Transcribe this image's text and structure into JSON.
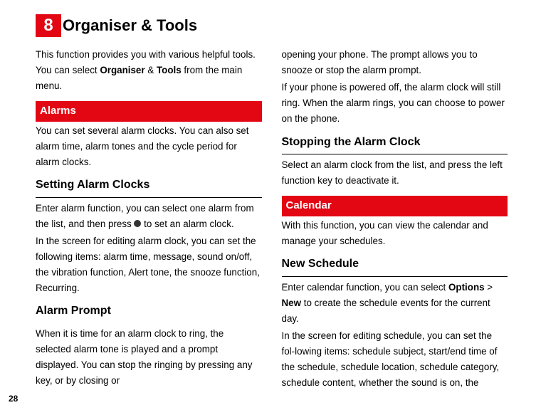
{
  "chapter": {
    "number": "8",
    "title": "Organiser & Tools"
  },
  "left": {
    "intro_pre": "This function provides you with various helpful tools. You can select ",
    "intro_bold1": "Organiser",
    "intro_amp": " & ",
    "intro_bold2": "Tools",
    "intro_post": " from the main menu.",
    "alarms_bar": "Alarms",
    "alarms_intro": "You can set several alarm clocks. You can also set alarm time, alarm tones and the cycle period for alarm clocks.",
    "setting_heading": "Setting Alarm Clocks",
    "setting_p1_pre": "Enter alarm function, you can select one alarm from the list, and then press ",
    "setting_p1_post": " to set an alarm clock.",
    "setting_p2": "In the screen for editing alarm clock, you can set the following items: alarm time, message, sound on/off, the vibration function, Alert tone, the snooze function, Recurring.",
    "prompt_heading": "Alarm Prompt",
    "prompt_p1": "When it is time for an alarm clock to ring, the selected alarm tone is played and a prompt displayed. You can stop the ringing by pressing any key, or by closing or"
  },
  "right": {
    "prompt_cont": "opening your phone. The prompt allows you to snooze or stop the alarm prompt.",
    "prompt_p2": "If your phone is powered off, the alarm clock will still ring. When the alarm rings, you can choose to power on the phone.",
    "stopping_heading": "Stopping the Alarm Clock",
    "stopping_p1": "Select an alarm clock from the list, and press the left function key to deactivate it.",
    "calendar_bar": "Calendar",
    "calendar_intro": "With this function, you can view the calendar and manage your schedules.",
    "newsched_heading": "New Schedule",
    "newsched_p1_pre": "Enter calendar function, you can select ",
    "newsched_bold1": "Options",
    "newsched_gt": " > ",
    "newsched_bold2": "New",
    "newsched_p1_post": " to create the schedule events for the current day.",
    "newsched_p2": "In the screen for editing schedule, you can set the fol-lowing items: schedule subject, start/end time of the schedule, schedule location, schedule category, schedule content,  whether the sound is on, the"
  },
  "page_number": "28"
}
